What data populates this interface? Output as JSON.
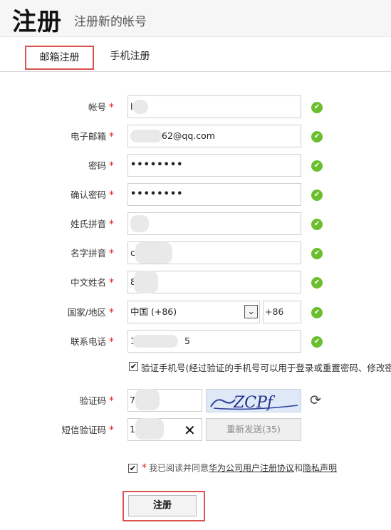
{
  "header": {
    "title": "注册",
    "subtitle": "注册新的帐号"
  },
  "tabs": [
    {
      "label": "邮箱注册",
      "active": true
    },
    {
      "label": "手机注册",
      "active": false
    }
  ],
  "form": {
    "account": {
      "label": "帐号",
      "value": "l"
    },
    "email": {
      "label": "电子邮箱",
      "value": "62@qq.com"
    },
    "password": {
      "label": "密码",
      "value": "••••••••"
    },
    "confirm_password": {
      "label": "确认密码",
      "value": "••••••••"
    },
    "surname_pinyin": {
      "label": "姓氏拼音",
      "value": ""
    },
    "given_name_pinyin": {
      "label": "名字拼音",
      "value": "c"
    },
    "chinese_name": {
      "label": "中文姓名",
      "value": "8"
    },
    "country": {
      "label": "国家/地区",
      "selected": "中国 (+86)",
      "prefix": "+86"
    },
    "phone": {
      "label": "联系电话",
      "value": "1",
      "suffix": "5"
    },
    "verify_phone": {
      "checked": true,
      "text": "验证手机号(经过验证的手机号可以用于登录或重置密码、修改密"
    },
    "captcha": {
      "label": "验证码",
      "value": "7",
      "image_text": "ZCPf"
    },
    "sms_code": {
      "label": "短信验证码",
      "value": "1",
      "resend_label": "重新发送(35)"
    },
    "agreement": {
      "checked": true,
      "prefix": "我已阅读并同意",
      "link1": "华为公司用户注册协议",
      "and": "和",
      "link2": "隐私声明"
    },
    "required_mark": "*"
  },
  "submit": {
    "label": "注册"
  },
  "icons": {
    "valid": "check-circle-icon",
    "refresh": "refresh-icon",
    "clear": "close-icon",
    "dropdown": "chevron-down-icon"
  },
  "colors": {
    "accent_red": "#d9534f",
    "valid_green": "#6bbf2e",
    "required_red": "#e02020"
  }
}
